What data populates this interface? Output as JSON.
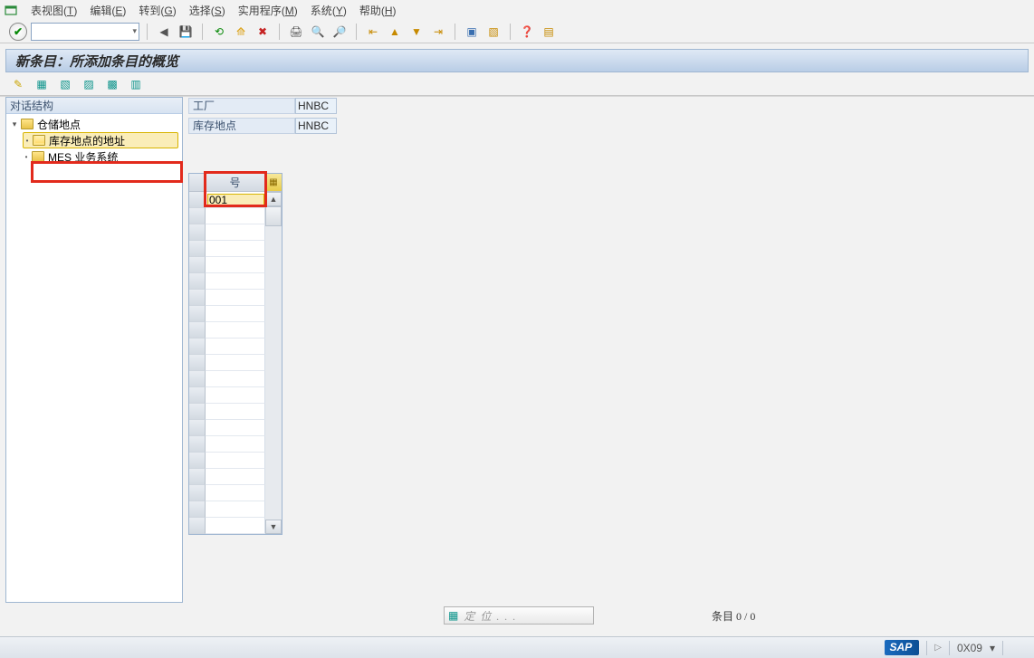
{
  "menu": {
    "items": [
      {
        "label": "表视图",
        "key": "T"
      },
      {
        "label": "编辑",
        "key": "E"
      },
      {
        "label": "转到",
        "key": "G"
      },
      {
        "label": "选择",
        "key": "S"
      },
      {
        "label": "实用程序",
        "key": "M"
      },
      {
        "label": "系统",
        "key": "Y"
      },
      {
        "label": "帮助",
        "key": "H"
      }
    ]
  },
  "title": "新条目：所添加条目的概览",
  "left": {
    "header": "对话结构",
    "nodes": [
      {
        "label": "仓储地点",
        "level": 0,
        "folder": "closed",
        "twisty": "▾"
      },
      {
        "label": "库存地点的地址",
        "level": 1,
        "folder": "open",
        "selected": true
      },
      {
        "label": "MES 业务系统",
        "level": 1,
        "folder": "closed"
      }
    ]
  },
  "kv": [
    {
      "label": "工厂",
      "value": "HNBC"
    },
    {
      "label": "库存地点",
      "value": "HNBC"
    }
  ],
  "grid": {
    "col_header": "号",
    "row0_value": "001",
    "empty_rows": 20
  },
  "footer": {
    "position_label": "定位...",
    "entry_label": "条目 0 / 0"
  },
  "status": {
    "sap": "SAP",
    "code": "0X09",
    "arrow": "▾"
  },
  "icons": {
    "back": "◀",
    "save": "💾",
    "green_ok": "✔",
    "red_x": "✖",
    "yellow_x": "⊗",
    "print": "🖨",
    "find": "🔍",
    "find_next": "🔎",
    "first": "⏮",
    "prev": "⏪",
    "next": "⏩",
    "last": "⏭",
    "new_sess": "▣",
    "shortcut": "🔗",
    "help": "❓",
    "layout": "▤",
    "wand": "✎",
    "row_a": "▦",
    "row_b": "▧",
    "row_c": "▨",
    "row_d": "▩",
    "row_e": "▥",
    "cfg": "▦",
    "sc_up": "▲",
    "sc_dn": "▼",
    "pos": "▦",
    "tri": "▷"
  }
}
